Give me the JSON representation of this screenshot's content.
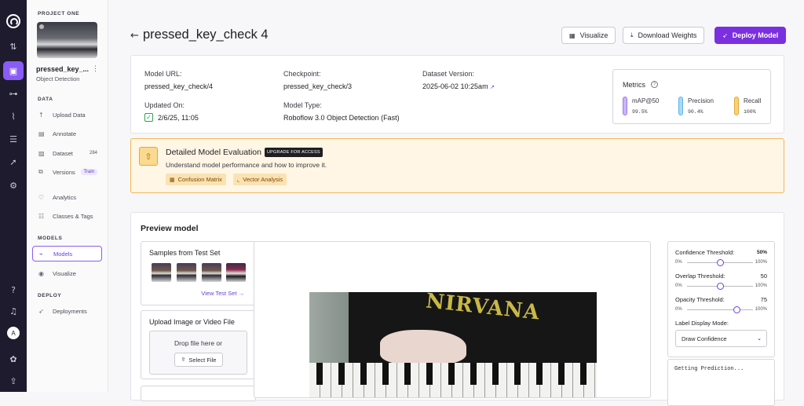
{
  "rail": {
    "avatar_initial": "A"
  },
  "sidebar": {
    "project_label": "PROJECT ONE",
    "project_name": "pressed_key_...",
    "project_type": "Object Detection",
    "sections": {
      "data": "DATA",
      "models": "MODELS",
      "deploy": "DEPLOY"
    },
    "items": [
      {
        "label": "Upload Data"
      },
      {
        "label": "Annotate"
      },
      {
        "label": "Dataset",
        "badge": "284"
      },
      {
        "label": "Versions",
        "pill": "Train"
      },
      {
        "label": "Analytics"
      },
      {
        "label": "Classes & Tags"
      },
      {
        "label": "Models"
      },
      {
        "label": "Visualize"
      },
      {
        "label": "Deployments"
      }
    ]
  },
  "header": {
    "title": "pressed_key_check 4",
    "visualize": "Visualize",
    "download": "Download Weights",
    "deploy": "Deploy Model"
  },
  "info": {
    "model_url_label": "Model URL:",
    "model_url": "pressed_key_check/4",
    "checkpoint_label": "Checkpoint:",
    "checkpoint": "pressed_key_check/3",
    "dataset_version_label": "Dataset Version:",
    "dataset_version": "2025-06-02 10:25am",
    "updated_label": "Updated On:",
    "updated": "2/6/25, 11:05",
    "model_type_label": "Model Type:",
    "model_type": "Roboflow 3.0 Object Detection (Fast)"
  },
  "metrics": {
    "title": "Metrics",
    "items": [
      {
        "name": "mAP@50",
        "value": "99.5%",
        "color": "#b79df2"
      },
      {
        "name": "Precision",
        "value": "90.4%",
        "color": "#86c9ef"
      },
      {
        "name": "Recall",
        "value": "100%",
        "color": "#f2c14e"
      }
    ]
  },
  "evaluation": {
    "title": "Detailed Model Evaluation",
    "tag": "UPGRADE FOR ACCESS",
    "subtitle": "Understand model performance and how to improve it.",
    "chips": [
      "Confusion Matrix",
      "Vector Analysis"
    ]
  },
  "preview": {
    "title": "Preview model",
    "samples_title": "Samples from Test Set",
    "view_test_set": "View Test Set →",
    "upload_title": "Upload Image or Video File",
    "drop_text": "Drop file here or",
    "select_file": "Select File",
    "image_text": "NIRVANA",
    "confidence_label": "Confidence Threshold:",
    "confidence_value": "50%",
    "confidence_level": 0.5,
    "overlap_label": "Overlap Threshold:",
    "overlap_value": "50",
    "overlap_level": 0.5,
    "opacity_label": "Opacity Threshold:",
    "opacity_value": "75",
    "opacity_level": 0.75,
    "slider_min": "0%",
    "slider_max": "100%",
    "label_mode_label": "Label Display Mode:",
    "label_mode_value": "Draw Confidence",
    "prediction_text": "Getting Prediction..."
  }
}
